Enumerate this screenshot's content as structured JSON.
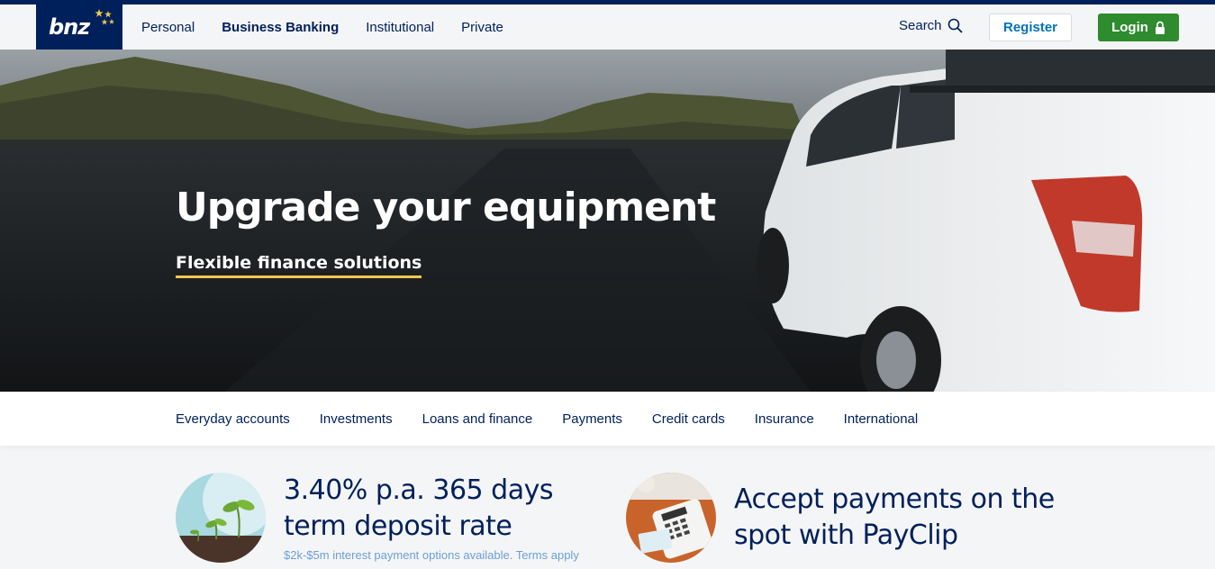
{
  "header": {
    "logo_text": "bnz",
    "nav": [
      "Personal",
      "Business Banking",
      "Institutional",
      "Private"
    ],
    "active_nav": "Business Banking",
    "search_label": "Search",
    "register_label": "Register",
    "login_label": "Login"
  },
  "hero": {
    "title": "Upgrade your equipment",
    "link_label": "Flexible finance solutions"
  },
  "subnav": {
    "items": [
      "Everyday accounts",
      "Investments",
      "Loans and finance",
      "Payments",
      "Credit cards",
      "Insurance",
      "International"
    ]
  },
  "promos": [
    {
      "title_line1": "3.40% p.a. 365 days",
      "title_line2": "term deposit rate",
      "subtitle": "$2k-$5m interest payment options available. Terms apply"
    },
    {
      "title_line1": "Accept payments on the",
      "title_line2": "spot with PayClip"
    }
  ],
  "colors": {
    "brand_navy": "#00205b",
    "login_green": "#2e8b2e",
    "register_blue": "#0072bc",
    "link_underline": "#f2c94c"
  }
}
